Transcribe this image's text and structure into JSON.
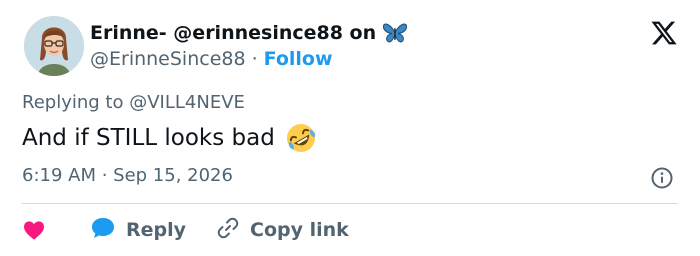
{
  "author": {
    "display_name": "Erinne- @erinnesince88 on",
    "handle": "@ErinneSince88",
    "separator": "·",
    "follow_label": "Follow"
  },
  "tweet": {
    "reply_prefix": "Replying to",
    "reply_handle": "@VILL4NEVE",
    "text": "And if STILL looks bad",
    "timestamp": "6:19 AM · Sep 15, 2026"
  },
  "actions": {
    "reply_label": "Reply",
    "copy_link_label": "Copy link"
  },
  "colors": {
    "accent": "#1d9bf0",
    "like": "#f91880",
    "muted": "#536471",
    "text": "#0f1419",
    "divider": "#cfd9de"
  },
  "icons": [
    "butterfly-emoji-icon",
    "x-logo-icon",
    "rolling-laughing-emoji-icon",
    "info-icon",
    "heart-icon",
    "reply-bubble-icon",
    "link-icon"
  ]
}
